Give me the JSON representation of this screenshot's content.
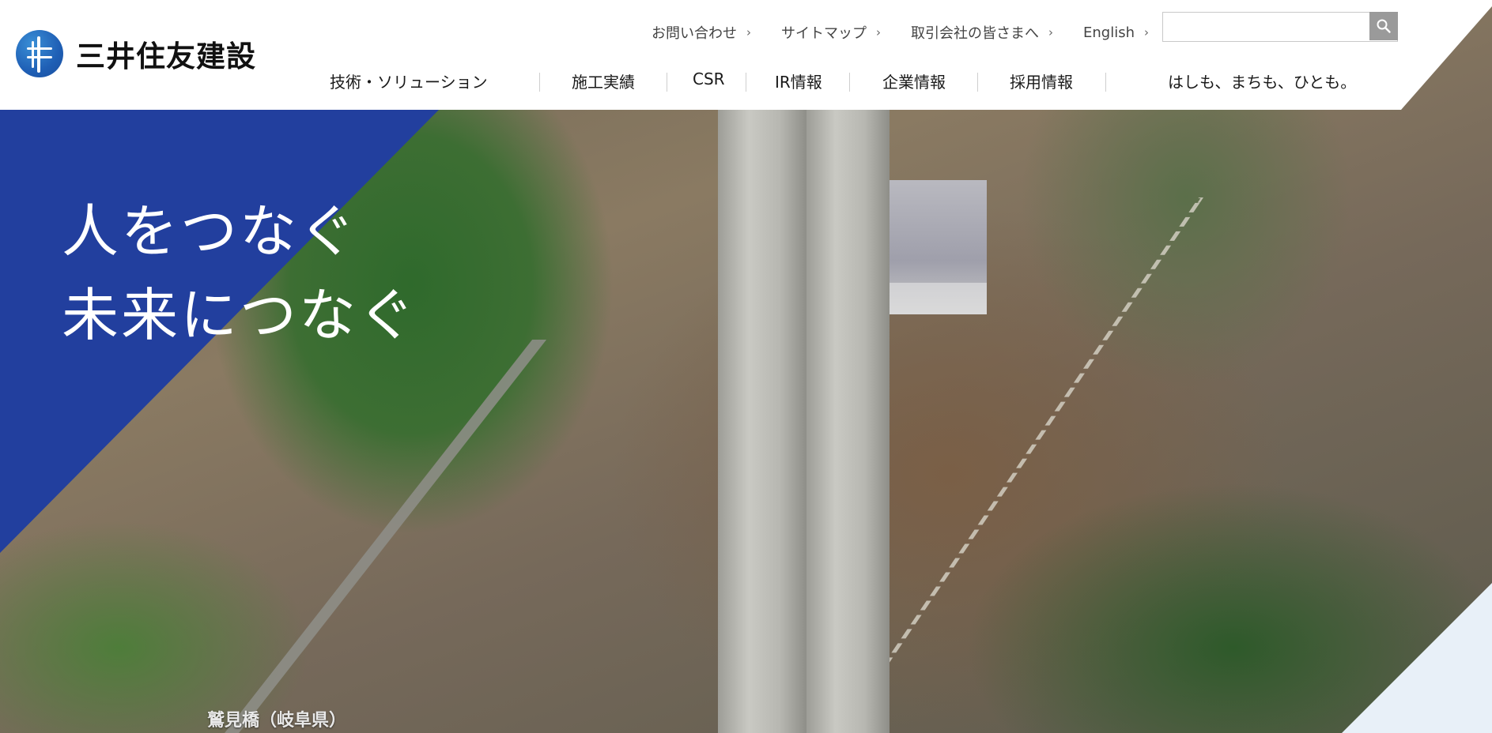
{
  "brand": {
    "name": "三井住友建設",
    "logo_icon": "company-logo-mark"
  },
  "utility_nav": [
    {
      "label": "お問い合わせ",
      "icon": "chevron-right-icon"
    },
    {
      "label": "サイトマップ",
      "icon": "chevron-right-icon"
    },
    {
      "label": "取引会社の皆さまへ",
      "icon": "chevron-right-icon"
    },
    {
      "label": "English",
      "icon": "chevron-right-icon"
    }
  ],
  "search": {
    "value": "",
    "placeholder": "",
    "button_icon": "search-icon"
  },
  "main_nav": [
    {
      "label": "技術・ソリューション"
    },
    {
      "label": "施工実績"
    },
    {
      "label": "CSR"
    },
    {
      "label": "IR情報"
    },
    {
      "label": "企業情報"
    },
    {
      "label": "採用情報"
    },
    {
      "label": "はしも、まちも、ひとも。"
    }
  ],
  "hero": {
    "tagline_line1": "人をつなぐ",
    "tagline_line2": "未来につなぐ",
    "caption": "鷲見橋（岐阜県）"
  },
  "colors": {
    "accent_blue": "#223f9e",
    "logo_blue": "#1f5fb5",
    "search_button": "#9a9a9a"
  }
}
